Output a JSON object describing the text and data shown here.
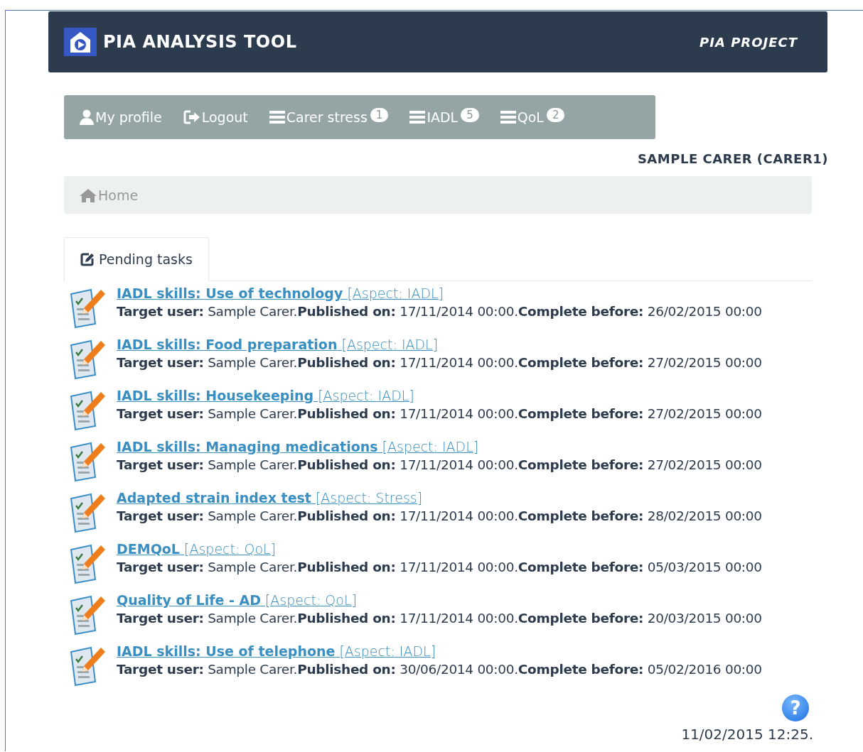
{
  "header": {
    "title": "PIA ANALYSIS TOOL",
    "project": "PIA PROJECT"
  },
  "nav": [
    {
      "kind": "user",
      "label": "My profile"
    },
    {
      "kind": "logout",
      "label": "Logout"
    },
    {
      "kind": "list",
      "label": "Carer stress",
      "count": "1"
    },
    {
      "kind": "list",
      "label": "IADL",
      "count": "5"
    },
    {
      "kind": "list",
      "label": "QoL",
      "count": "2"
    }
  ],
  "user_name": "SAMPLE CARER (CARER1)",
  "breadcrumb": {
    "label": "Home"
  },
  "tabs": [
    {
      "label": "Pending tasks",
      "selected": true
    }
  ],
  "tasks": [
    {
      "title": "**IADL skills: Use of technology** [Aspect: IADL]",
      "details": "**Target user:** Sample Carer.**Published on:** 17/11/2014 00:00.**Complete before:** 26/02/2015 00:00"
    },
    {
      "title": "**IADL skills: Food preparation** [Aspect: IADL]",
      "details": "**Target user:** Sample Carer.**Published on:** 17/11/2014 00:00.**Complete before:** 27/02/2015 00:00"
    },
    {
      "title": "**IADL skills: Housekeeping** [Aspect: IADL]",
      "details": "**Target user:** Sample Carer.**Published on:** 17/11/2014 00:00.**Complete before:** 27/02/2015 00:00"
    },
    {
      "title": "**IADL skills: Managing medications** [Aspect: IADL]",
      "details": "**Target user:** Sample Carer.**Published on:** 17/11/2014 00:00.**Complete before:** 27/02/2015 00:00"
    },
    {
      "title": "**Adapted strain index test** [Aspect: Stress]",
      "details": "**Target user:** Sample Carer.**Published on:** 17/11/2014 00:00.**Complete before:** 28/02/2015 00:00"
    },
    {
      "title": "**DEMQoL** [Aspect: QoL]",
      "details": "**Target user:** Sample Carer.**Published on:** 17/11/2014 00:00.**Complete before:** 05/03/2015 00:00"
    },
    {
      "title": "**Quality of Life - AD** [Aspect: QoL]",
      "details": "**Target user:** Sample Carer.**Published on:** 17/11/2014 00:00.**Complete before:** 20/03/2015 00:00"
    },
    {
      "title": "**IADL skills: Use of telephone** [Aspect: IADL]",
      "details": "**Target user:** Sample Carer.**Published on:** 30/06/2014 00:00.**Complete before:** 05/02/2016 00:00"
    }
  ],
  "help": {
    "label": "?"
  },
  "timestamp": "11/02/2015 12:25."
}
